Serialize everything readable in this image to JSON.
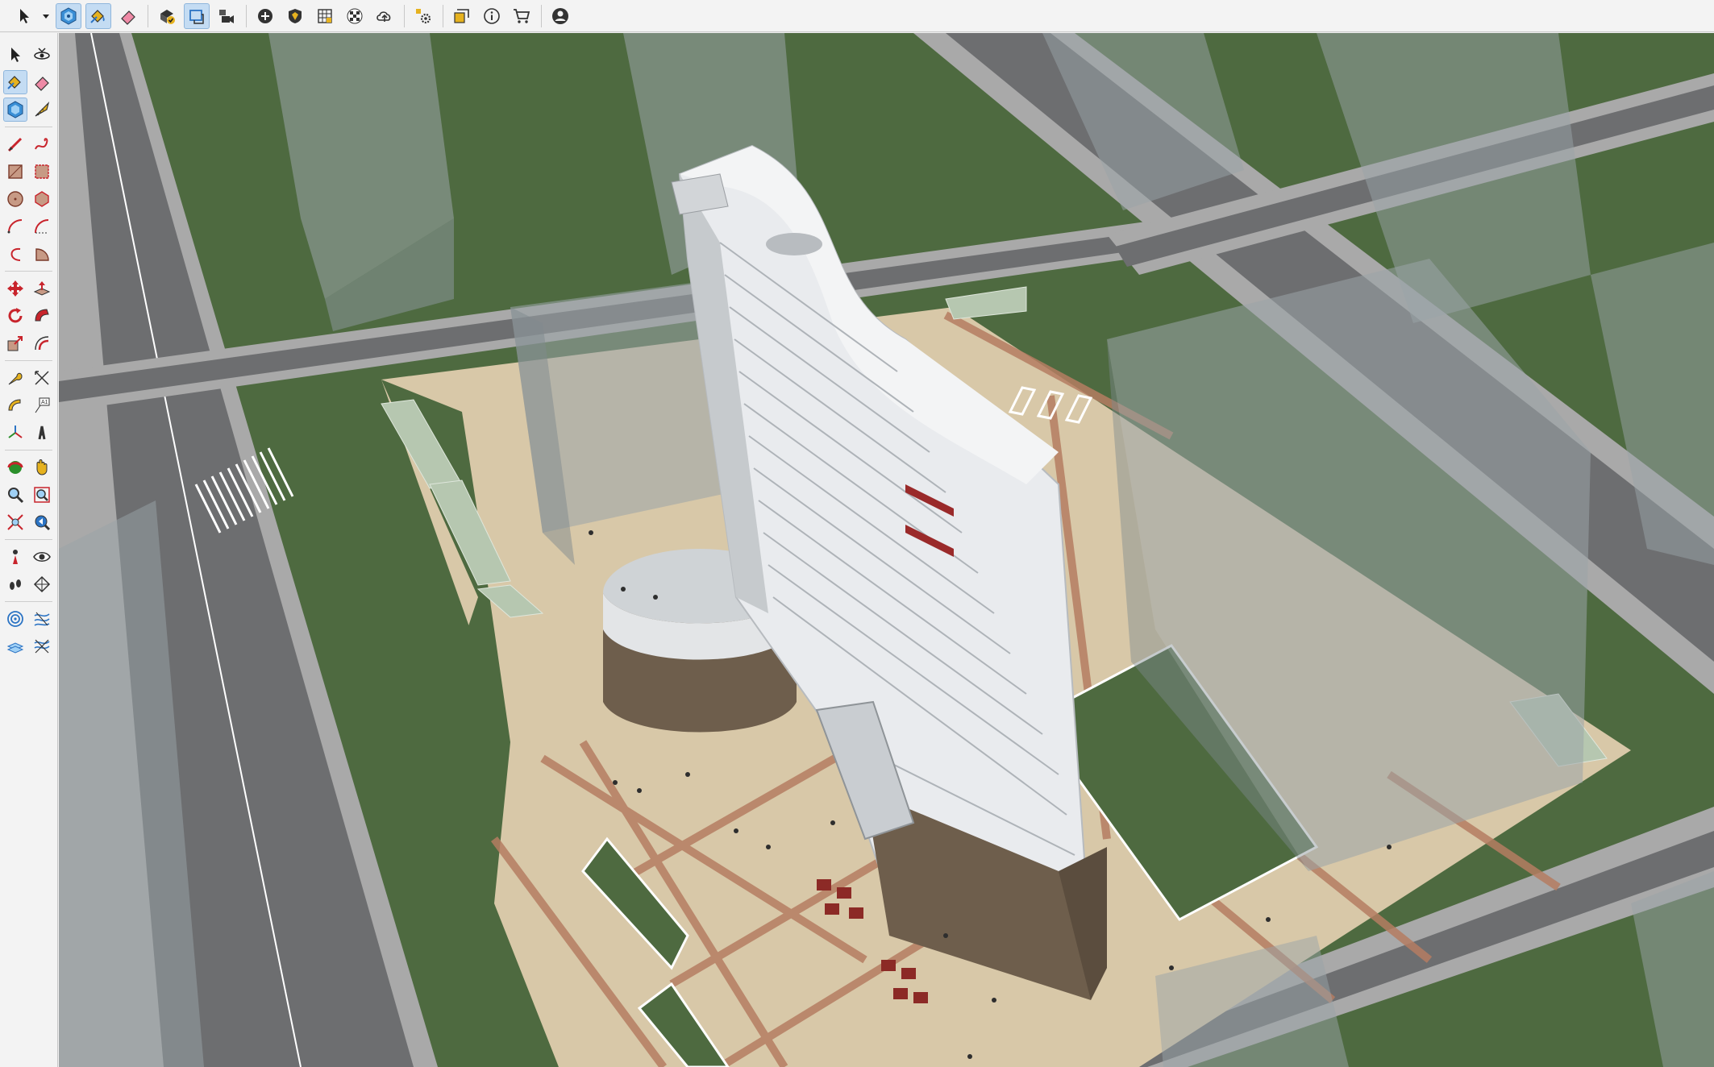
{
  "app": "SketchUp",
  "top_toolbar": {
    "tools": [
      {
        "name": "select-tool-icon",
        "active": false
      },
      {
        "name": "dropdown-caret-icon",
        "active": false
      },
      {
        "name": "components-icon",
        "active": true
      },
      {
        "name": "paint-bucket-icon",
        "active": true
      },
      {
        "name": "eraser-icon",
        "active": false
      },
      {
        "name": "warehouse-check-icon",
        "active": false
      },
      {
        "name": "section-plane-icon",
        "active": true
      },
      {
        "name": "scene-camera-icon",
        "active": false
      },
      {
        "name": "add-location-icon",
        "active": false
      },
      {
        "name": "geolocate-icon",
        "active": false
      },
      {
        "name": "sandbox-icon",
        "active": false
      },
      {
        "name": "checker-material-icon",
        "active": false
      },
      {
        "name": "cloud-upload-icon",
        "active": false
      },
      {
        "name": "extension-manager-icon",
        "active": false
      },
      {
        "name": "layers-panel-icon",
        "active": false
      },
      {
        "name": "info-icon",
        "active": false
      },
      {
        "name": "extension-store-icon",
        "active": false
      },
      {
        "name": "account-icon",
        "active": false
      }
    ]
  },
  "left_toolbar": {
    "rows": [
      [
        "select-arrow-icon",
        "orbit-icon"
      ],
      [
        "paint-bucket-icon",
        "eraser-icon"
      ],
      [
        "component-icon",
        "tape-measure-icon"
      ],
      [
        "line-pencil-icon",
        "freehand-icon"
      ],
      [
        "rectangle-icon",
        "rotated-rectangle-icon"
      ],
      [
        "circle-icon",
        "polygon-icon"
      ],
      [
        "arc-icon",
        "two-point-arc-icon"
      ],
      [
        "three-point-arc-icon",
        "pie-icon"
      ],
      [
        "move-icon",
        "push-pull-icon"
      ],
      [
        "rotate-icon",
        "follow-me-icon"
      ],
      [
        "scale-icon",
        "offset-icon"
      ],
      [
        "tape-measure-icon-2",
        "dimension-icon"
      ],
      [
        "protractor-icon",
        "text-label-icon"
      ],
      [
        "axes-icon",
        "3d-text-icon"
      ],
      [
        "orbit-tool-icon",
        "pan-hand-icon"
      ],
      [
        "zoom-icon",
        "zoom-window-icon"
      ],
      [
        "zoom-extents-icon",
        "previous-view-icon"
      ],
      [
        "position-camera-icon",
        "look-around-icon"
      ],
      [
        "walk-icon",
        "section-plane-tool-icon"
      ],
      [
        "sandbox-from-contours-icon",
        "sandbox-from-scratch-icon"
      ],
      [
        "smoove-icon",
        "stamp-icon"
      ]
    ]
  },
  "viewport": {
    "scene": "3d-model-highrise-site",
    "colors": {
      "grass": "#4e6a40",
      "road": "#6d6e70",
      "sidewalk": "#b3b3b3",
      "plaza": "#d8c8a8",
      "paving_stripe": "#b57d62",
      "building_white": "#e9ebee",
      "building_brown": "#6e5e4c",
      "glass_mass": "#9aa4a8"
    }
  }
}
